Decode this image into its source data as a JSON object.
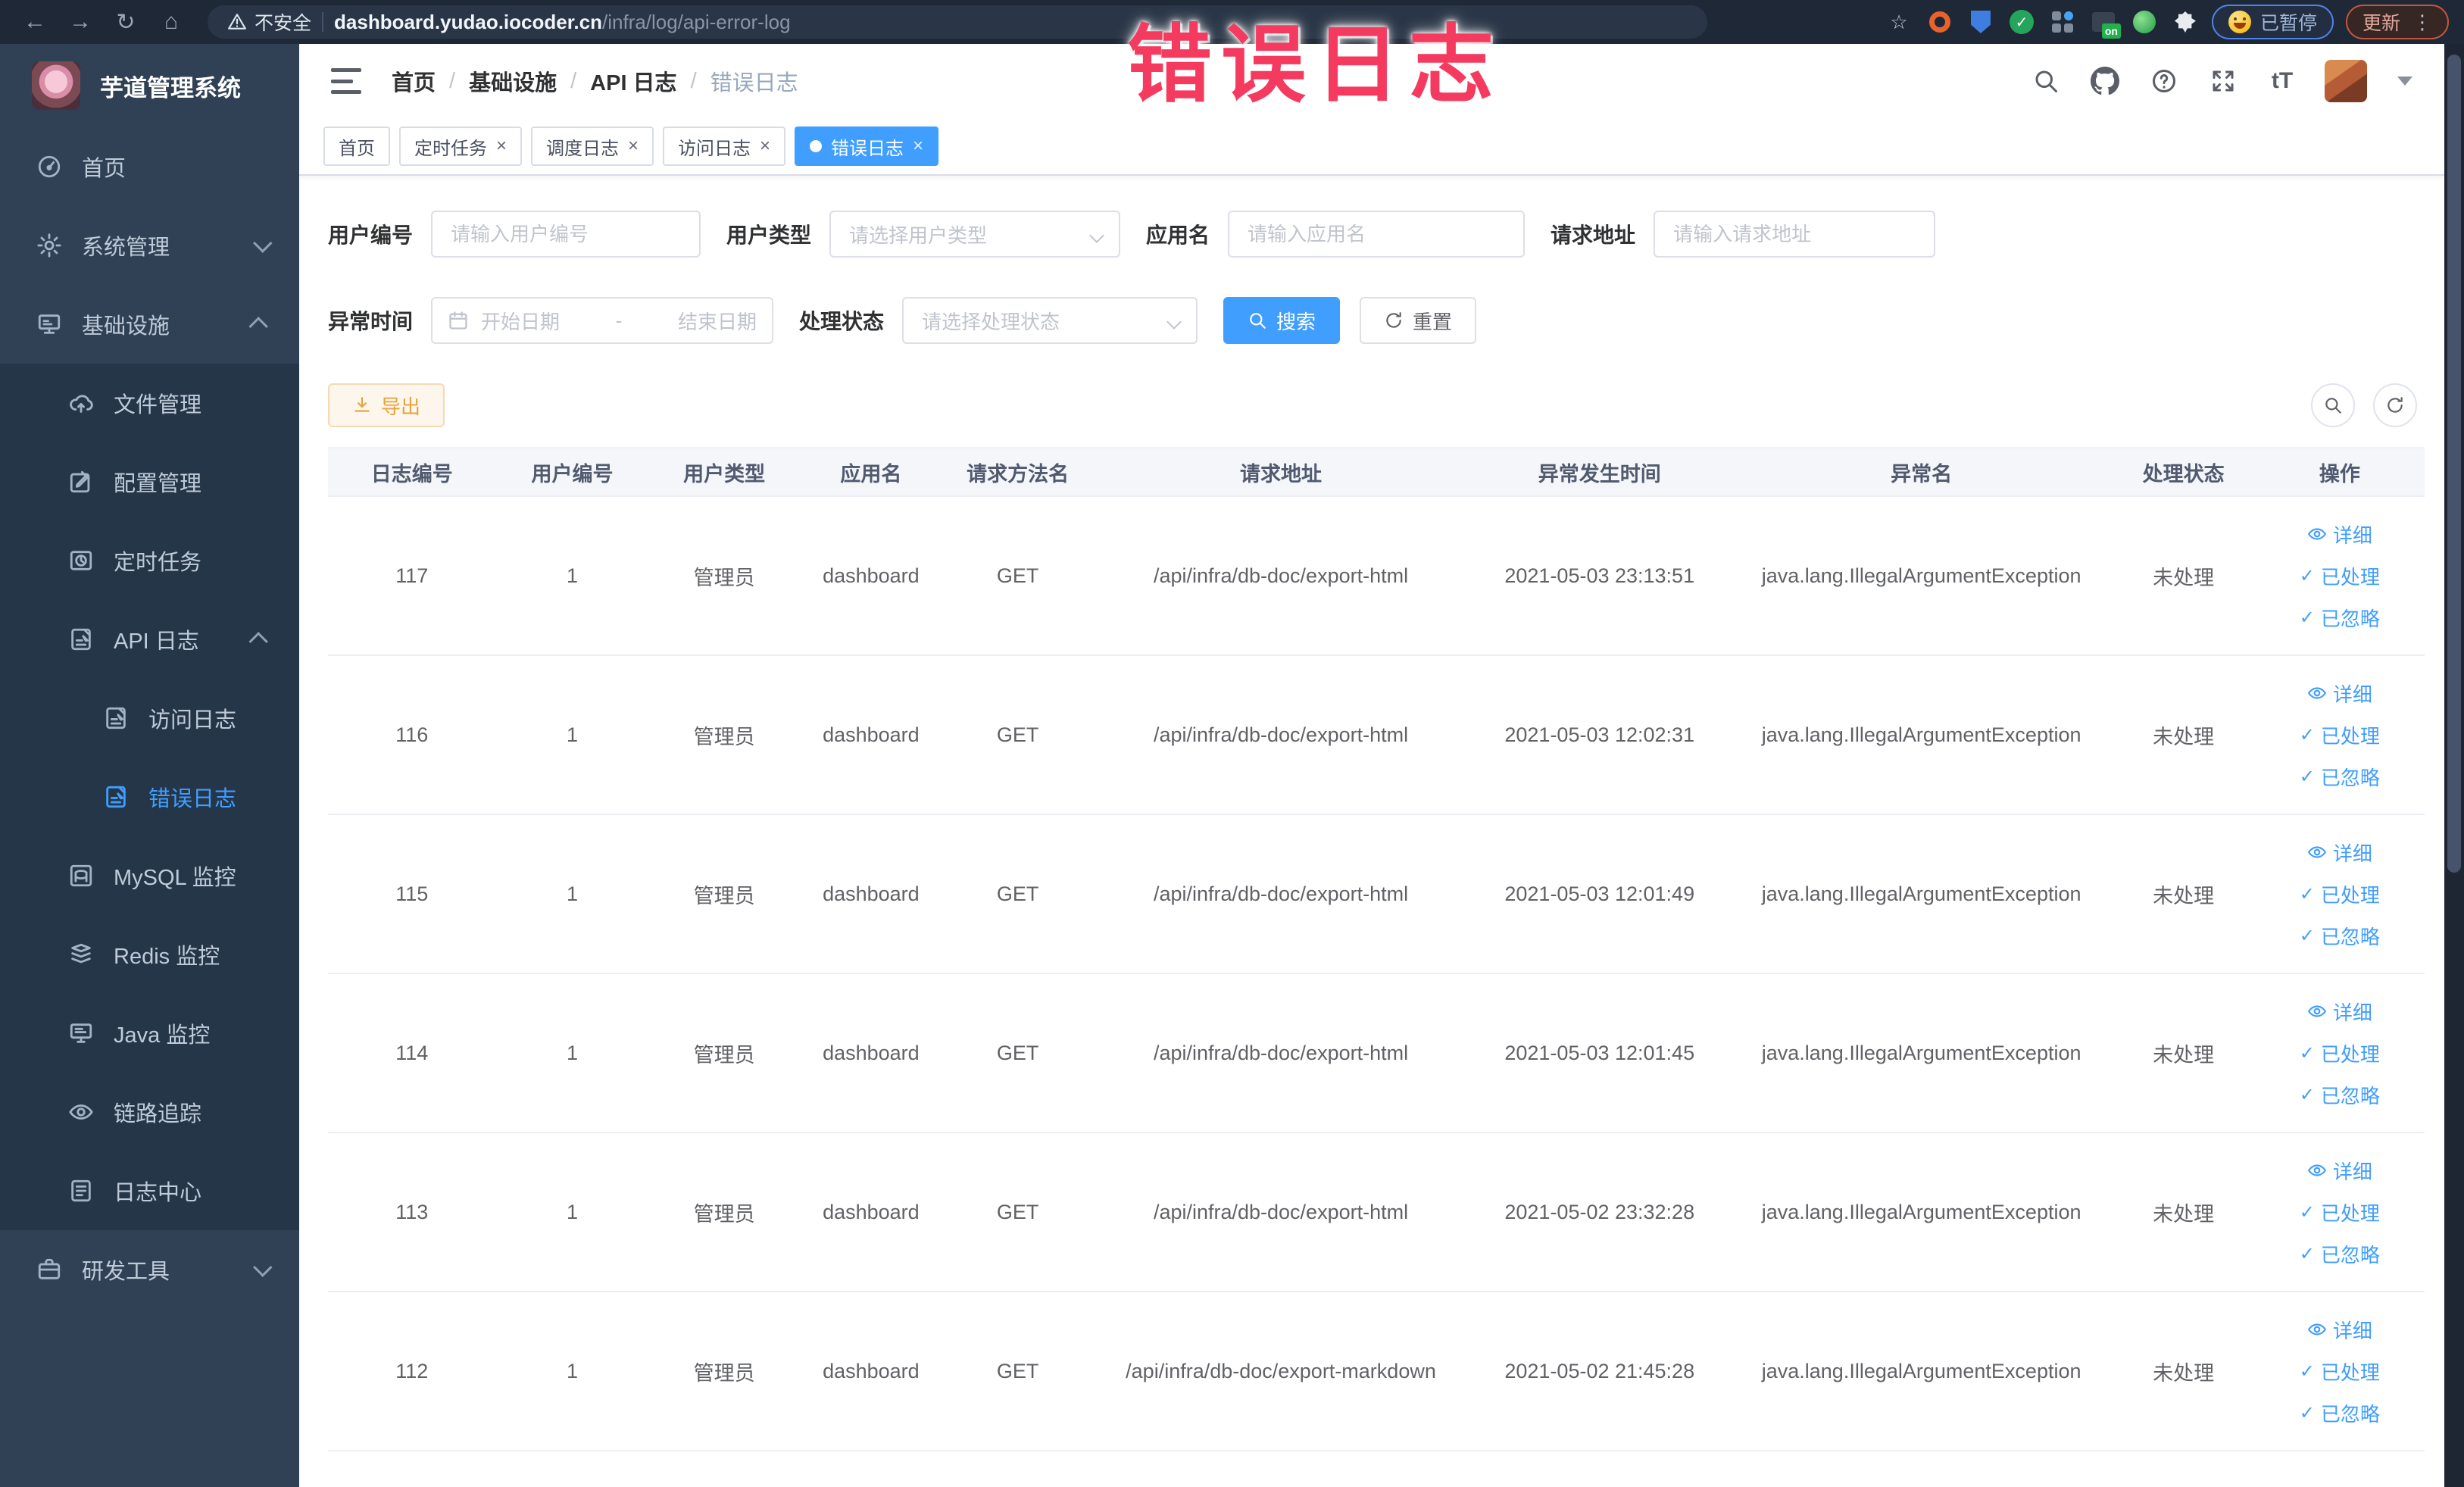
{
  "colors": {
    "accent": "#409eff",
    "warning": "#e6a23c",
    "overlay_red": "#f43b5f",
    "sidebar_bg": "#304156",
    "submenu_bg": "#253649"
  },
  "browser": {
    "security_label": "不安全",
    "url_host": "dashboard.yudao.iocoder.cn",
    "url_path": "/infra/log/api-error-log",
    "paused_label": "已暂停",
    "update_label": "更新"
  },
  "overlay": {
    "text": "错误日志"
  },
  "sidebar": {
    "title": "芋道管理系统",
    "items": [
      {
        "label": "首页",
        "icon": "home-icon",
        "level": 1
      },
      {
        "label": "系统管理",
        "icon": "gear-icon",
        "level": 1,
        "arrow": "down"
      },
      {
        "label": "基础设施",
        "icon": "infra-icon",
        "level": 1,
        "arrow": "up"
      },
      {
        "label": "文件管理",
        "icon": "cloud-upload-icon",
        "level": 2,
        "group": true
      },
      {
        "label": "配置管理",
        "icon": "edit-icon",
        "level": 2,
        "group": true
      },
      {
        "label": "定时任务",
        "icon": "timer-icon",
        "level": 2,
        "group": true
      },
      {
        "label": "API 日志",
        "icon": "log-doc-icon",
        "level": 2,
        "group": true,
        "arrow": "up"
      },
      {
        "label": "访问日志",
        "icon": "log-doc-icon",
        "level": 3,
        "group": true
      },
      {
        "label": "错误日志",
        "icon": "log-doc-icon",
        "level": 3,
        "group": true,
        "active": true
      },
      {
        "label": "MySQL 监控",
        "icon": "mysql-icon",
        "level": 2,
        "group": true
      },
      {
        "label": "Redis 监控",
        "icon": "redis-icon",
        "level": 2,
        "group": true
      },
      {
        "label": "Java 监控",
        "icon": "java-monitor-icon",
        "level": 2,
        "group": true
      },
      {
        "label": "链路追踪",
        "icon": "trace-eye-icon",
        "level": 2,
        "group": true
      },
      {
        "label": "日志中心",
        "icon": "log-center-icon",
        "level": 2,
        "group": true
      },
      {
        "label": "研发工具",
        "icon": "toolbox-icon",
        "level": 1,
        "arrow": "down"
      }
    ]
  },
  "breadcrumb": {
    "items": [
      "首页",
      "基础设施",
      "API 日志",
      "错误日志"
    ],
    "separator": "/"
  },
  "tabs": [
    {
      "label": "首页",
      "closable": false,
      "active": false
    },
    {
      "label": "定时任务",
      "closable": true,
      "active": false
    },
    {
      "label": "调度日志",
      "closable": true,
      "active": false
    },
    {
      "label": "访问日志",
      "closable": true,
      "active": false
    },
    {
      "label": "错误日志",
      "closable": true,
      "active": true
    }
  ],
  "filters": {
    "user_id": {
      "label": "用户编号",
      "placeholder": "请输入用户编号"
    },
    "user_type": {
      "label": "用户类型",
      "placeholder": "请选择用户类型"
    },
    "app_name": {
      "label": "应用名",
      "placeholder": "请输入应用名"
    },
    "request_url": {
      "label": "请求地址",
      "placeholder": "请输入请求地址"
    },
    "exception_time": {
      "label": "异常时间",
      "start_placeholder": "开始日期",
      "separator": "-",
      "end_placeholder": "结束日期"
    },
    "process_status": {
      "label": "处理状态",
      "placeholder": "请选择处理状态"
    },
    "search_label": "搜索",
    "reset_label": "重置"
  },
  "toolbar": {
    "export_label": "导出"
  },
  "table": {
    "headers": [
      "日志编号",
      "用户编号",
      "用户类型",
      "应用名",
      "请求方法名",
      "请求地址",
      "异常发生时间",
      "异常名",
      "处理状态",
      "操作"
    ],
    "action_labels": [
      "详细",
      "已处理",
      "已忽略"
    ],
    "rows": [
      {
        "id": "117",
        "user_id": "1",
        "user_type": "管理员",
        "app": "dashboard",
        "method": "GET",
        "url": "/api/infra/db-doc/export-html",
        "time": "2021-05-03 23:13:51",
        "exception": "java.lang.IllegalArgumentException",
        "status": "未处理"
      },
      {
        "id": "116",
        "user_id": "1",
        "user_type": "管理员",
        "app": "dashboard",
        "method": "GET",
        "url": "/api/infra/db-doc/export-html",
        "time": "2021-05-03 12:02:31",
        "exception": "java.lang.IllegalArgumentException",
        "status": "未处理"
      },
      {
        "id": "115",
        "user_id": "1",
        "user_type": "管理员",
        "app": "dashboard",
        "method": "GET",
        "url": "/api/infra/db-doc/export-html",
        "time": "2021-05-03 12:01:49",
        "exception": "java.lang.IllegalArgumentException",
        "status": "未处理"
      },
      {
        "id": "114",
        "user_id": "1",
        "user_type": "管理员",
        "app": "dashboard",
        "method": "GET",
        "url": "/api/infra/db-doc/export-html",
        "time": "2021-05-03 12:01:45",
        "exception": "java.lang.IllegalArgumentException",
        "status": "未处理"
      },
      {
        "id": "113",
        "user_id": "1",
        "user_type": "管理员",
        "app": "dashboard",
        "method": "GET",
        "url": "/api/infra/db-doc/export-html",
        "time": "2021-05-02 23:32:28",
        "exception": "java.lang.IllegalArgumentException",
        "status": "未处理"
      },
      {
        "id": "112",
        "user_id": "1",
        "user_type": "管理员",
        "app": "dashboard",
        "method": "GET",
        "url": "/api/infra/db-doc/export-markdown",
        "time": "2021-05-02 21:45:28",
        "exception": "java.lang.IllegalArgumentException",
        "status": "未处理"
      }
    ]
  }
}
